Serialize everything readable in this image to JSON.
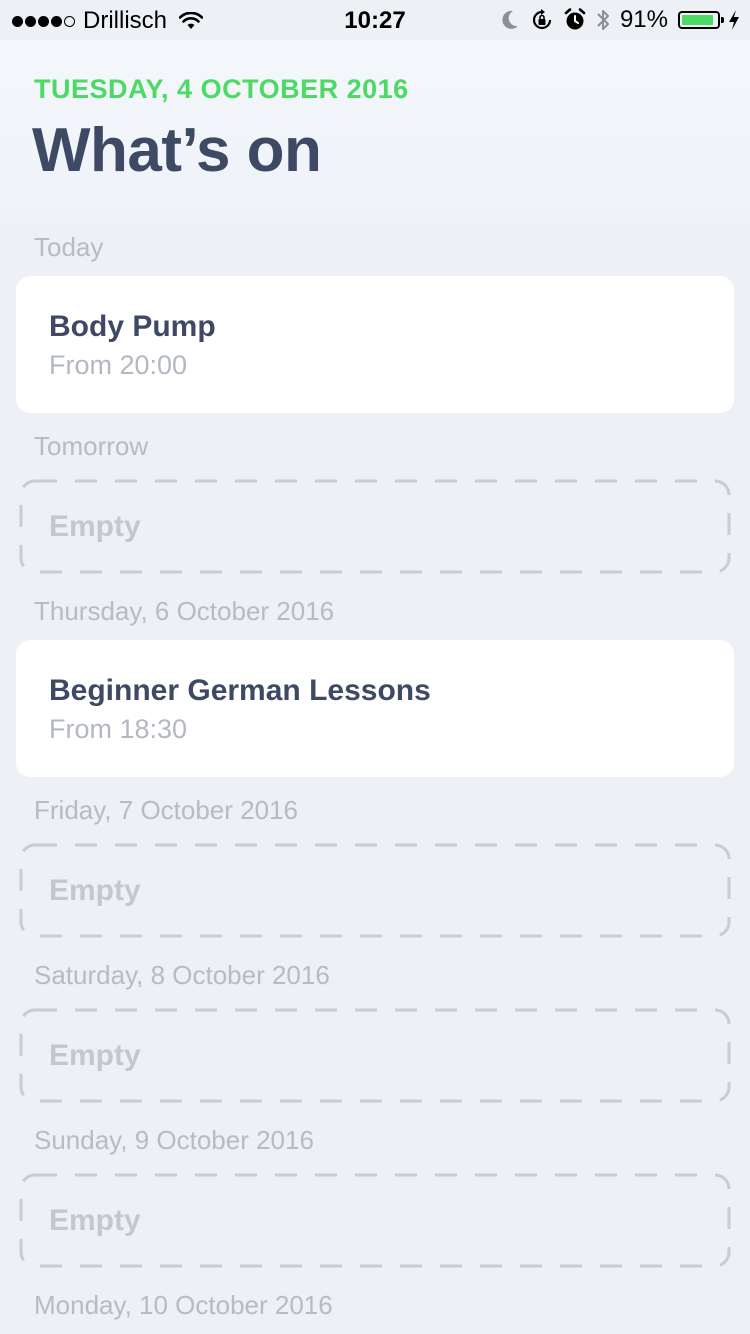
{
  "status_bar": {
    "carrier": "Drillisch",
    "time": "10:27",
    "battery_percent": "91%",
    "battery_level": 0.91,
    "signal_icon": "signal-dots",
    "wifi_icon": "wifi-icon",
    "right_icons": [
      "moon-icon",
      "rotation-lock-icon",
      "alarm-icon",
      "bluetooth-icon"
    ],
    "charging_icon": "bolt-icon"
  },
  "header": {
    "date": "TUESDAY, 4 OCTOBER 2016",
    "title": "What’s on",
    "date_color": "#4cd964",
    "title_color": "#3e4a64"
  },
  "days": [
    {
      "label": "Today",
      "event": {
        "title": "Body Pump",
        "time": "From 20:00"
      }
    },
    {
      "label": "Tomorrow",
      "empty_text": "Empty"
    },
    {
      "label": "Thursday, 6 October 2016",
      "event": {
        "title": "Beginner German Lessons",
        "time": "From 18:30"
      }
    },
    {
      "label": "Friday, 7 October 2016",
      "empty_text": "Empty"
    },
    {
      "label": "Saturday, 8 October 2016",
      "empty_text": "Empty"
    },
    {
      "label": "Sunday, 9 October 2016",
      "empty_text": "Empty"
    },
    {
      "label": "Monday, 10 October 2016"
    }
  ]
}
